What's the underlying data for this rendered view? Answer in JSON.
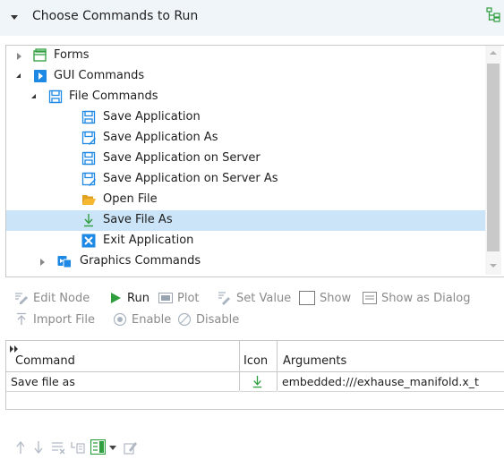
{
  "header": {
    "title": "Choose Commands to Run"
  },
  "tree": {
    "items": [
      {
        "label": "Forms",
        "icon": "forms-icon",
        "expander": "closed"
      },
      {
        "label": "GUI Commands",
        "icon": "gui-commands-icon",
        "expander": "open"
      },
      {
        "label": "File Commands",
        "icon": "save-icon",
        "expander": "open"
      },
      {
        "label": "Save Application",
        "icon": "save-icon"
      },
      {
        "label": "Save Application As",
        "icon": "save-as-icon"
      },
      {
        "label": "Save Application on Server",
        "icon": "save-icon"
      },
      {
        "label": "Save Application on Server As",
        "icon": "save-as-icon"
      },
      {
        "label": "Open File",
        "icon": "folder-open-icon"
      },
      {
        "label": "Save File As",
        "icon": "download-arrow-icon",
        "selected": true
      },
      {
        "label": "Exit Application",
        "icon": "close-x-icon"
      },
      {
        "label": "Graphics Commands",
        "icon": "graphics-commands-icon",
        "expander": "closed"
      }
    ]
  },
  "toolbar1": {
    "edit_node": "Edit Node",
    "run": "Run",
    "plot": "Plot",
    "set_value": "Set Value",
    "show": "Show",
    "show_as_dialog": "Show as Dialog"
  },
  "toolbar2": {
    "import_file": "Import File",
    "enable": "Enable",
    "disable": "Disable"
  },
  "table": {
    "columns": [
      "Command",
      "Icon",
      "Arguments"
    ],
    "rows": [
      {
        "command": "Save file as",
        "icon": "download-arrow-icon",
        "arguments": "embedded:///exhause_manifold.x_t"
      }
    ]
  },
  "colors": {
    "accent": "#1e88e5",
    "selection": "#cce4f7",
    "header_bg": "#f0f5fa",
    "green": "#2e9e3e"
  }
}
